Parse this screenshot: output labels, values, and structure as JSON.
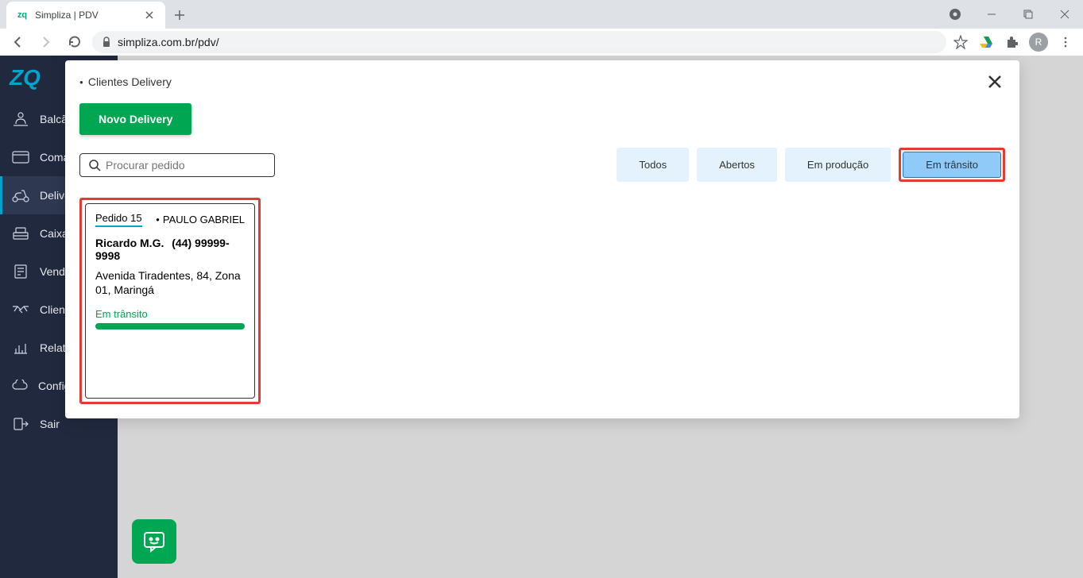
{
  "browser": {
    "tab_title": "Simpliza | PDV",
    "url": "simpliza.com.br/pdv/",
    "avatar_letter": "R"
  },
  "sidebar": {
    "logo": "ZQ",
    "items": [
      {
        "label": "Balcão"
      },
      {
        "label": "Comandas"
      },
      {
        "label": "Delivery"
      },
      {
        "label": "Caixa"
      },
      {
        "label": "Vendas"
      },
      {
        "label": "Clientes"
      },
      {
        "label": "Relatórios"
      },
      {
        "label": "Configurações"
      },
      {
        "label": "Sair"
      }
    ]
  },
  "modal": {
    "title": "Clientes Delivery",
    "new_delivery_label": "Novo Delivery",
    "search_placeholder": "Procurar pedido",
    "filters": {
      "all": "Todos",
      "open": "Abertos",
      "production": "Em produção",
      "transit": "Em trânsito"
    },
    "order": {
      "number": "Pedido 15",
      "user": "PAULO GABRIEL",
      "customer_name": "Ricardo M.G.",
      "customer_phone": "(44) 99999-9998",
      "address": "Avenida Tiradentes, 84, Zona 01, Maringá",
      "status": "Em trânsito"
    }
  }
}
